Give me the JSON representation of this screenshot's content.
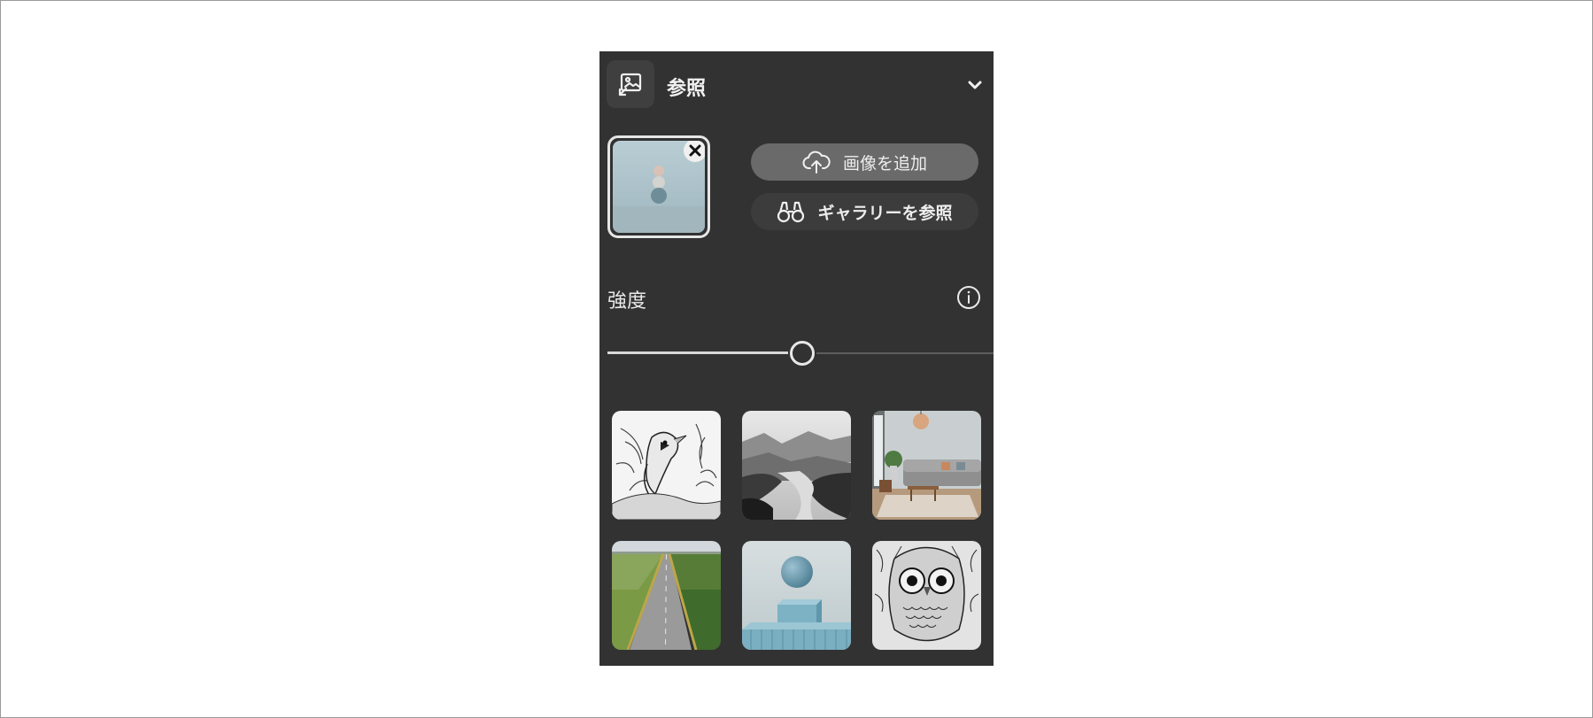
{
  "panel": {
    "title": "参照",
    "reference_image": {
      "alt": "reference image thumbnail"
    },
    "add_image_label": "画像を追加",
    "browse_gallery_label": "ギャラリーを参照",
    "strength_label": "強度",
    "strength_value": 0.5
  },
  "gallery": [
    {
      "name": "bird-sketch"
    },
    {
      "name": "misty-river"
    },
    {
      "name": "living-room"
    },
    {
      "name": "road-fields"
    },
    {
      "name": "sphere-cube"
    },
    {
      "name": "owl-sketch"
    }
  ],
  "icons": {
    "header": "image-reference-icon",
    "collapse": "chevron-down-icon",
    "remove": "close-icon",
    "upload": "cloud-upload-icon",
    "gallery": "binoculars-icon",
    "info": "info-icon"
  },
  "colors": {
    "panel_bg": "#323232",
    "add_button_bg": "#6a6a6a",
    "gallery_button_bg": "#3c3c3c",
    "text": "#e8e8e8"
  }
}
